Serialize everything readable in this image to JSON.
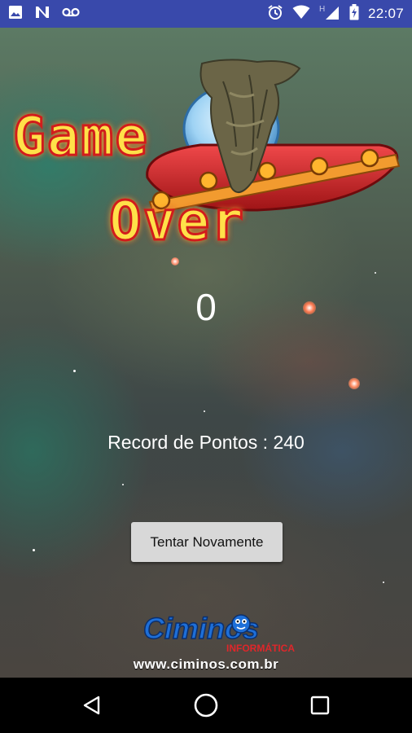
{
  "status_bar": {
    "time": "22:07",
    "network_label": "H",
    "icons": [
      "image-icon",
      "n-app-icon",
      "voicemail-icon",
      "alarm-icon",
      "wifi-icon",
      "signal-icon",
      "battery-charging-icon"
    ]
  },
  "game": {
    "title_line1": "Game",
    "title_line2": "Over",
    "score": "0",
    "record_text": "Record de Pontos : 240",
    "retry_label": "Tentar Novamente"
  },
  "branding": {
    "name": "Ciminos",
    "subtitle": "INFORMÁTICA",
    "url": "www.ciminos.com.br"
  },
  "nav_bar": {
    "icons": [
      "back-icon",
      "home-icon",
      "recents-icon"
    ]
  },
  "colors": {
    "status_bar": "#3949ab",
    "title_fill": "#ffe14a",
    "title_outline": "#d11a1a",
    "button_bg": "#d8d8d8"
  }
}
